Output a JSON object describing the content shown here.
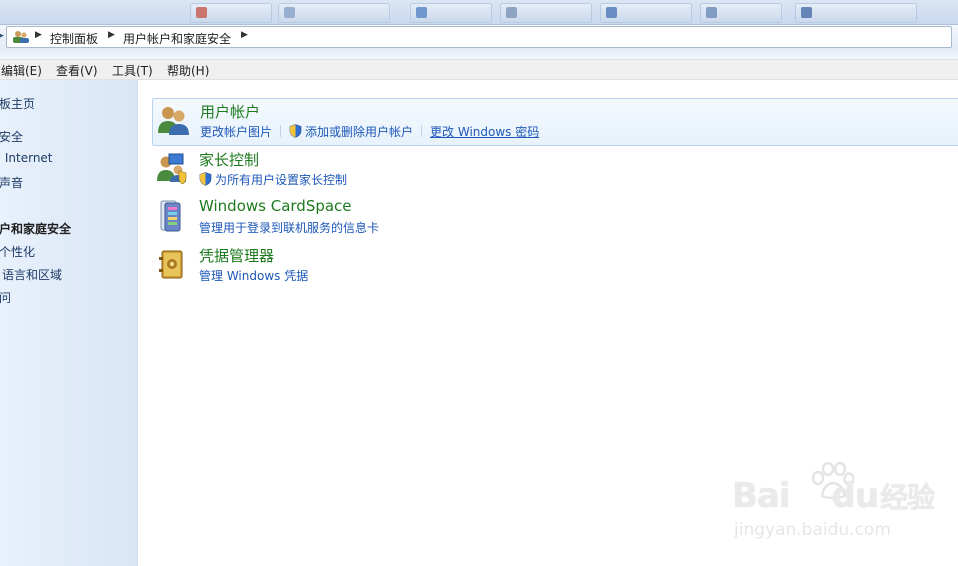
{
  "address_bar": {
    "breadcrumbs": [
      "控制面板",
      "用户帐户和家庭安全"
    ]
  },
  "menu": {
    "items": [
      "编辑(E)",
      "查看(V)",
      "工具(T)",
      "帮助(H)"
    ]
  },
  "sidebar": {
    "items": [
      {
        "label": "板主页"
      },
      {
        "label": "安全"
      },
      {
        "label": "Internet"
      },
      {
        "label": "声音"
      },
      {
        "label": "户和家庭安全",
        "current": true
      },
      {
        "label": "个性化"
      },
      {
        "label": "语言和区域"
      },
      {
        "label": "问"
      }
    ]
  },
  "categories": [
    {
      "title": "用户帐户",
      "icon": "user-accounts-icon",
      "links": [
        {
          "label": "更改帐户图片",
          "shield": false
        },
        {
          "label": "添加或删除用户帐户",
          "shield": true
        },
        {
          "label": "更改 Windows 密码",
          "shield": false
        }
      ]
    },
    {
      "title": "家长控制",
      "icon": "parental-controls-icon",
      "links": [
        {
          "label": "为所有用户设置家长控制",
          "shield": true
        }
      ]
    },
    {
      "title": "Windows CardSpace",
      "icon": "cardspace-icon",
      "links": [
        {
          "label": "管理用于登录到联机服务的信息卡",
          "shield": false
        }
      ]
    },
    {
      "title": "凭据管理器",
      "icon": "credential-manager-icon",
      "links": [
        {
          "label": "管理 Windows 凭据",
          "shield": false
        }
      ]
    }
  ],
  "watermark": {
    "brand_left": "Bai",
    "brand_right": "du",
    "brand_cn": "经验",
    "url": "jingyan.baidu.com"
  },
  "colors": {
    "link": "#1e58b8",
    "category_title": "#1e7a1e",
    "sidebar_bg": "#dde8f7"
  }
}
